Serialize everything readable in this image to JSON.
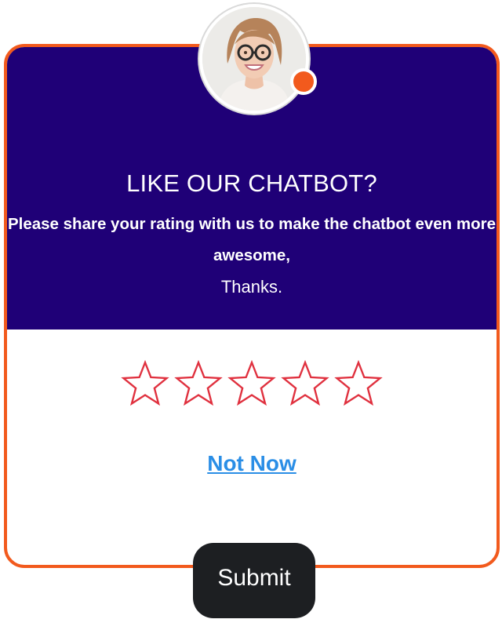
{
  "dialog": {
    "title": "LIKE OUR CHATBOT?",
    "message": "Please share your rating with us to make the chatbot even more awesome,",
    "thanks": "Thanks.",
    "rating": {
      "value": 0,
      "max": 5,
      "icon": "star-outline-icon"
    },
    "not_now_label": "Not Now",
    "submit_label": "Submit",
    "avatar": {
      "icon": "agent-avatar-icon",
      "status_icon": "online-status-dot"
    }
  },
  "colors": {
    "accent": "#f25a1d",
    "header_bg": "#1f0077",
    "star": "#e0313f",
    "link": "#2a8ee6",
    "button_bg": "#1d1f22"
  }
}
